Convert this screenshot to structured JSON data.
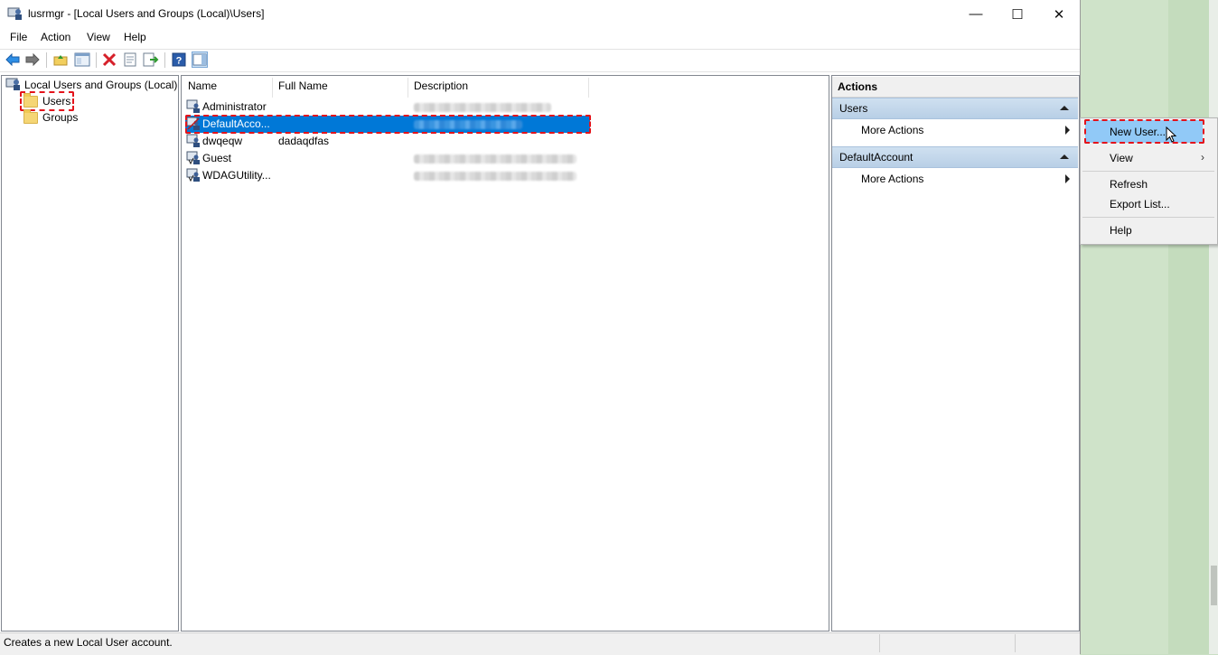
{
  "window": {
    "title": "lusrmgr - [Local Users and Groups (Local)\\Users]",
    "controls": {
      "minimize": "—",
      "maximize": "☐",
      "close": "✕"
    }
  },
  "menu": [
    "File",
    "Action",
    "View",
    "Help"
  ],
  "toolbar": {
    "icons": [
      "back-arrow-icon",
      "forward-arrow-icon",
      "up-folder-icon",
      "show-hide-tree-icon",
      "delete-icon",
      "properties-icon",
      "export-list-icon",
      "help-icon",
      "show-hide-action-pane-icon"
    ]
  },
  "tree": {
    "root": "Local Users and Groups (Local)",
    "children": [
      "Users",
      "Groups"
    ],
    "selected": "Users"
  },
  "list": {
    "columns": [
      "Name",
      "Full Name",
      "Description"
    ],
    "rows": [
      {
        "name": "Administrator",
        "full_name": "",
        "description_blurred": true
      },
      {
        "name": "DefaultAcco...",
        "full_name": "",
        "description_blurred": true,
        "selected": true
      },
      {
        "name": "dwqeqw",
        "full_name": "dadaqdfas",
        "description_blurred": false
      },
      {
        "name": "Guest",
        "full_name": "",
        "description_blurred": true
      },
      {
        "name": "WDAGUtility...",
        "full_name": "",
        "description_blurred": true
      }
    ]
  },
  "actions": {
    "header": "Actions",
    "sections": [
      {
        "title": "Users",
        "items": [
          "More Actions"
        ]
      },
      {
        "title": "DefaultAccount",
        "items": [
          "More Actions"
        ]
      }
    ]
  },
  "context_menu": {
    "items": [
      "New User...",
      "View",
      "Refresh",
      "Export List...",
      "Help"
    ],
    "highlighted": "New User..."
  },
  "status": {
    "text": "Creates a new Local User account."
  },
  "colors": {
    "selection": "#0078d7",
    "highlight_box": "#e3131b",
    "menu_hover": "#91c9f7",
    "section_bg": "#c4d8ec"
  }
}
